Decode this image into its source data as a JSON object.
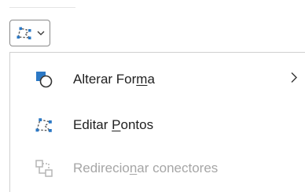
{
  "menu": {
    "items": [
      {
        "label_before": "Alterar For",
        "label_underline": "m",
        "label_after": "a",
        "has_submenu": true,
        "enabled": true,
        "icon": "change-shape-icon"
      },
      {
        "label_before": "Editar ",
        "label_underline": "P",
        "label_after": "ontos",
        "has_submenu": false,
        "enabled": true,
        "icon": "edit-points-icon"
      },
      {
        "label_before": "Redirecio",
        "label_underline": "n",
        "label_after": "ar conectores",
        "has_submenu": false,
        "enabled": false,
        "icon": "reroute-connectors-icon"
      }
    ]
  },
  "colors": {
    "accent_blue": "#2b78c5",
    "text": "#1f1f1f",
    "disabled_text": "#a6a6a6"
  }
}
